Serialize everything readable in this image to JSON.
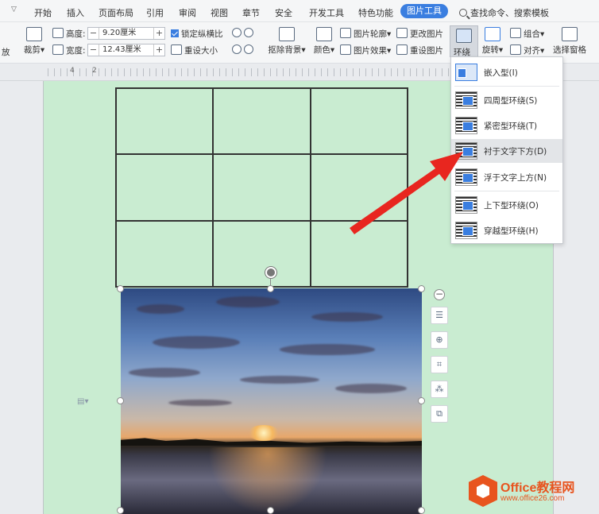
{
  "menubar": {
    "dropdown_icon": "chevron-down-icon",
    "tabs": [
      "开始",
      "插入",
      "页面布局",
      "引用",
      "审阅",
      "视图",
      "章节",
      "安全",
      "开发工具",
      "特色功能",
      "图片工具"
    ],
    "active_tab": "图片工具",
    "search_label": "查找命令、搜索模板"
  },
  "ribbon": {
    "left_cut_label": "放",
    "crop_label": "裁剪",
    "height_label": "高度:",
    "height_value": "9.20厘米",
    "width_label": "宽度:",
    "width_value": "12.43厘米",
    "lock_ratio_label": "锁定纵横比",
    "reset_size_label": "重设大小",
    "remove_bg_label": "抠除背景",
    "color_label": "颜色",
    "outline_label": "图片轮廓",
    "effects_label": "图片效果",
    "change_label": "更改图片",
    "reset_pic_label": "重设图片",
    "wrap_label": "环绕",
    "rotate_label": "旋转",
    "group_label": "组合",
    "align_label": "对齐",
    "selection_pane_label": "选择窗格"
  },
  "ruler": {
    "labels": [
      "4",
      "2"
    ]
  },
  "wrap_menu": {
    "items": [
      {
        "label": "嵌入型(I)",
        "highlighted": false
      },
      {
        "label": "四周型环绕(S)",
        "highlighted": false
      },
      {
        "label": "紧密型环绕(T)",
        "highlighted": false
      },
      {
        "label": "衬于文字下方(D)",
        "highlighted": true
      },
      {
        "label": "浮于文字上方(N)",
        "highlighted": false
      },
      {
        "label": "上下型环绕(O)",
        "highlighted": false
      },
      {
        "label": "穿越型环绕(H)",
        "highlighted": false
      }
    ]
  },
  "side_tools": [
    "minus-icon",
    "wrap-icon",
    "zoom-icon",
    "crop-icon",
    "stitch-icon",
    "convert-icon"
  ],
  "colors": {
    "accent": "#3a7ee0",
    "page": "#c9ecd1",
    "arrow": "#e8261f",
    "brand": "#e8541e"
  },
  "watermark": {
    "brand": "Office教程网",
    "url": "www.office26.com"
  }
}
